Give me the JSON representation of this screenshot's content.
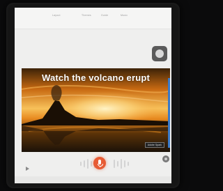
{
  "nav": {
    "tabs": [
      "Layout",
      "Themes",
      "Guide",
      "Music"
    ]
  },
  "banner": {
    "title": "Watch the volcano erupt",
    "watermark": "Adobe Spark"
  },
  "icons": {
    "float": "record-circle-icon",
    "play": "play-icon",
    "mic": "microphone-icon",
    "settings": "settings-icon"
  },
  "colors": {
    "accent": "#e75c35",
    "sky_top": "#f2c46b",
    "sky_mid": "#f08a1d",
    "water": "#3a2a12"
  }
}
